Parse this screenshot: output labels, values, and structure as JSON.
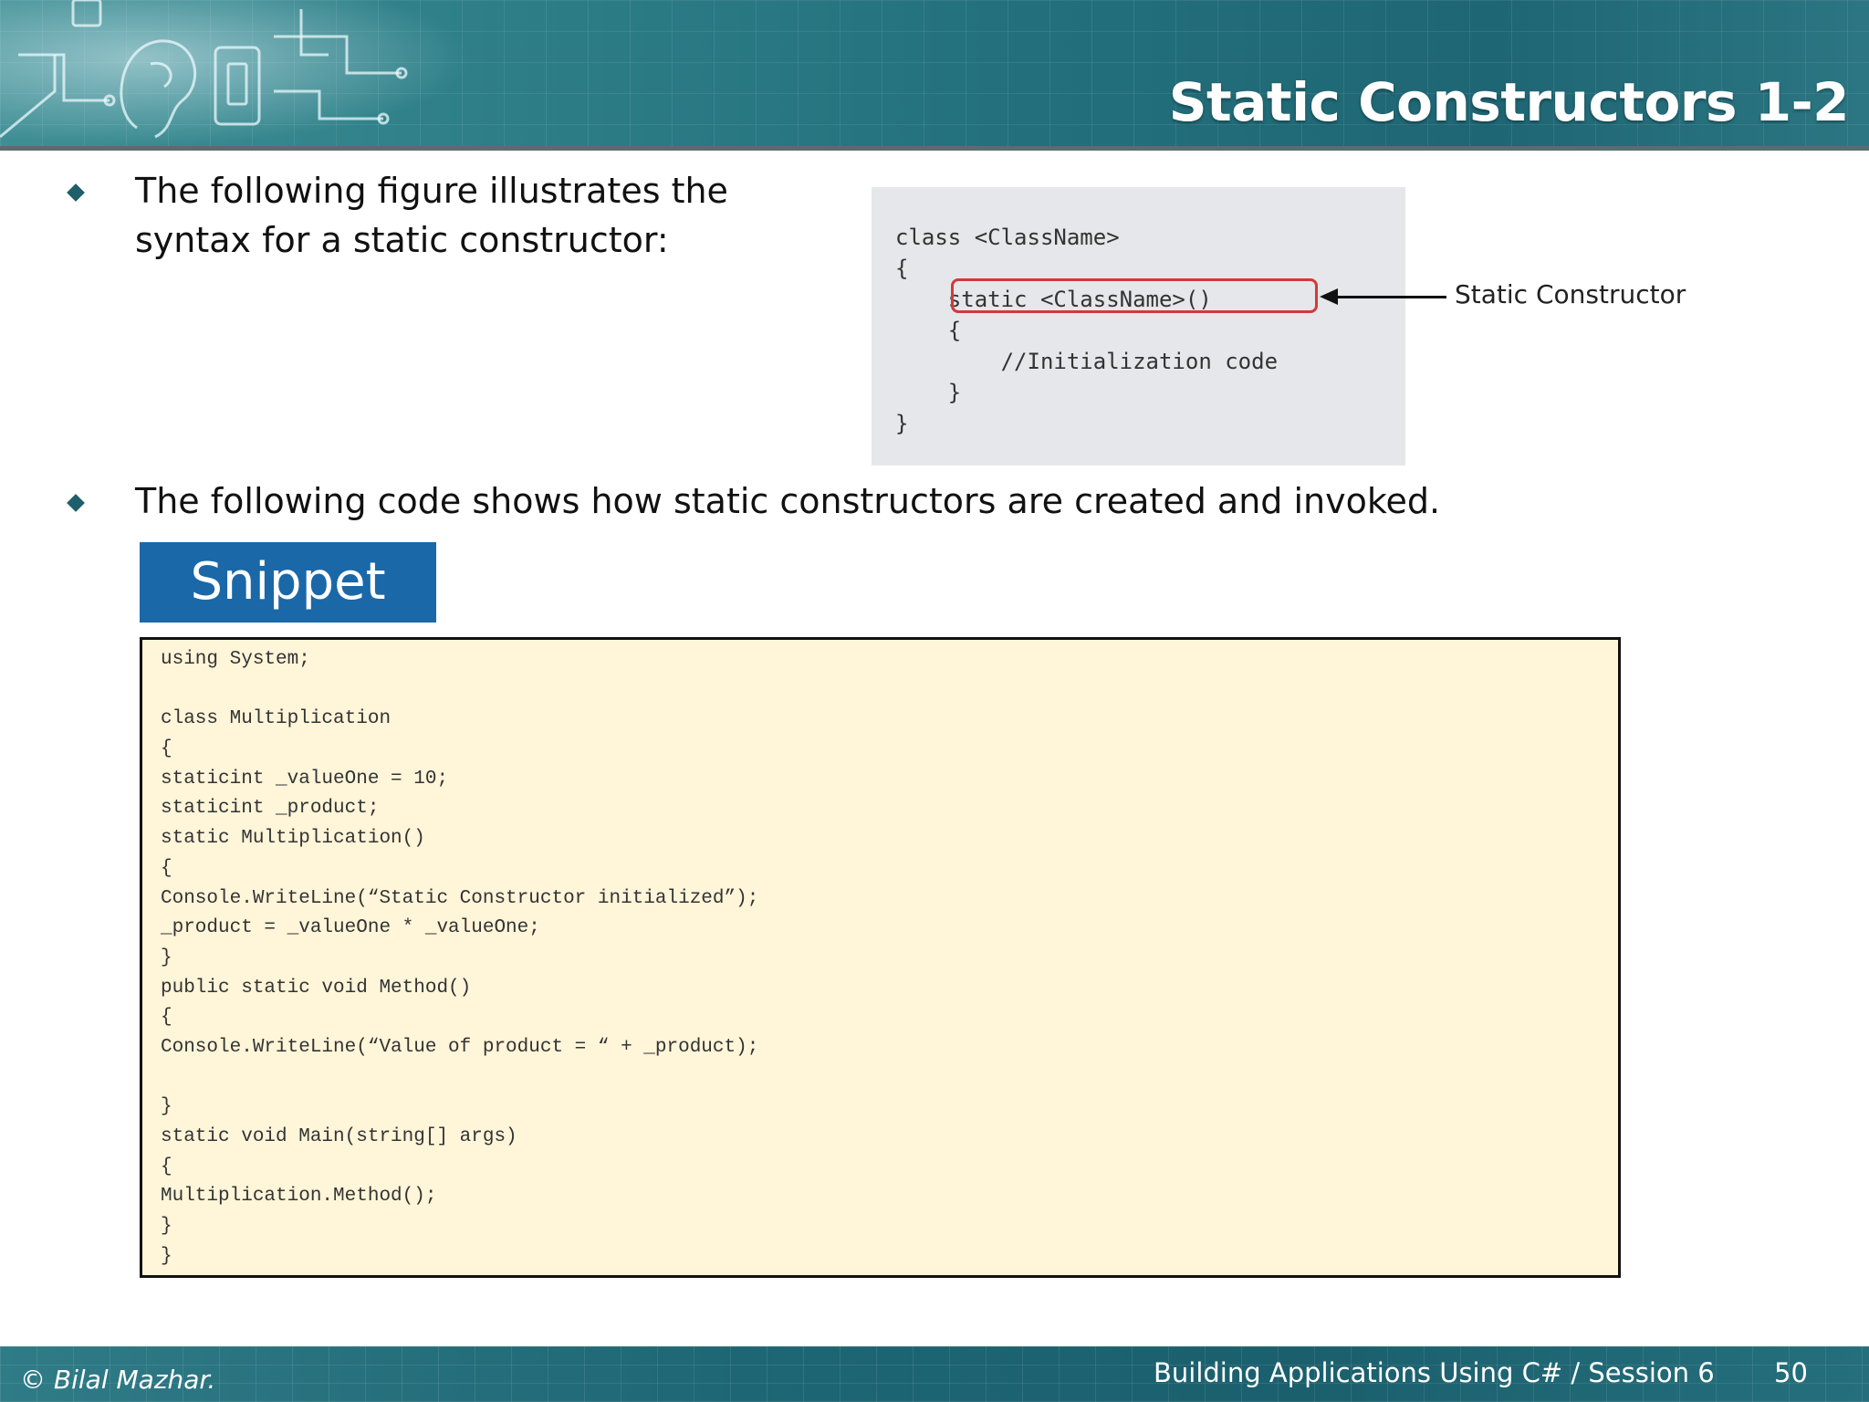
{
  "header": {
    "title": "Static Constructors 1-2"
  },
  "bullets": [
    {
      "text": "The following figure illustrates the syntax for a static constructor:"
    },
    {
      "text": "The following code shows how static constructors are created and invoked."
    }
  ],
  "syntax_figure": {
    "code": "class <ClassName>\n{\n    static <ClassName>()\n    {\n        //Initialization code\n    }\n}",
    "callout_label": "Static Constructor"
  },
  "snippet": {
    "tab_label": "Snippet",
    "lines": [
      "using System;",
      "",
      "class Multiplication",
      "{",
      "staticint _valueOne = 10;",
      "staticint _product;",
      "static Multiplication()",
      "{",
      "Console.WriteLine(“Static Constructor initialized”);",
      "_product = _valueOne * _valueOne;",
      "}",
      "public static void Method()",
      "{",
      "Console.WriteLine(“Value of product = “ + _product);",
      "",
      "}",
      "static void Main(string[] args)",
      "{",
      "Multiplication.Method();",
      "}",
      "}"
    ]
  },
  "footer": {
    "copyright": "© Bilal Mazhar.",
    "course": "Building Applications Using C# / Session 6",
    "page_number": "50"
  },
  "colors": {
    "header_teal": "#23707c",
    "snippet_tab_blue": "#1a68a8",
    "code_background": "#fff5d9",
    "highlight_red": "#d23a3a"
  }
}
